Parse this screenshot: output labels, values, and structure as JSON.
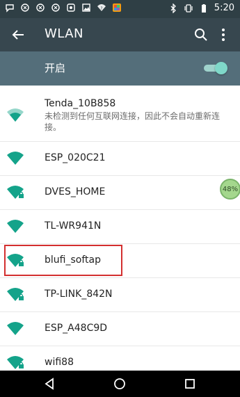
{
  "status_bar": {
    "time": "5:20",
    "icons": [
      "chat-icon",
      "app-icon",
      "app-icon",
      "app-icon",
      "app-icon",
      "gallery-icon",
      "wifi-question-icon",
      "notification-icon",
      "bluetooth-icon",
      "vibrate-icon",
      "battery-icon"
    ]
  },
  "header": {
    "title": "WLAN"
  },
  "toggle": {
    "label": "开启",
    "state": "on"
  },
  "networks": [
    {
      "ssid": "Tenda_10B858",
      "status": "未检测到任何互联网连接，因此不会自动重新连接。",
      "locked": false
    },
    {
      "ssid": "ESP_020C21",
      "locked": false
    },
    {
      "ssid": "DVES_HOME",
      "locked": true
    },
    {
      "ssid": "TL-WR941N",
      "locked": false
    },
    {
      "ssid": "blufi_softap",
      "locked": true,
      "highlighted": true
    },
    {
      "ssid": "TP-LINK_842N",
      "locked": true
    },
    {
      "ssid": "ESP_A48C9D",
      "locked": false
    },
    {
      "ssid": "wifi88",
      "locked": true
    }
  ],
  "badge": {
    "text": "48%"
  },
  "colors": {
    "statusbar": "#2f3f45",
    "appbar": "#37474f",
    "togglebar": "#546e7a",
    "wifi_icon": "#14a38a",
    "highlight_border": "#d32f2f"
  }
}
